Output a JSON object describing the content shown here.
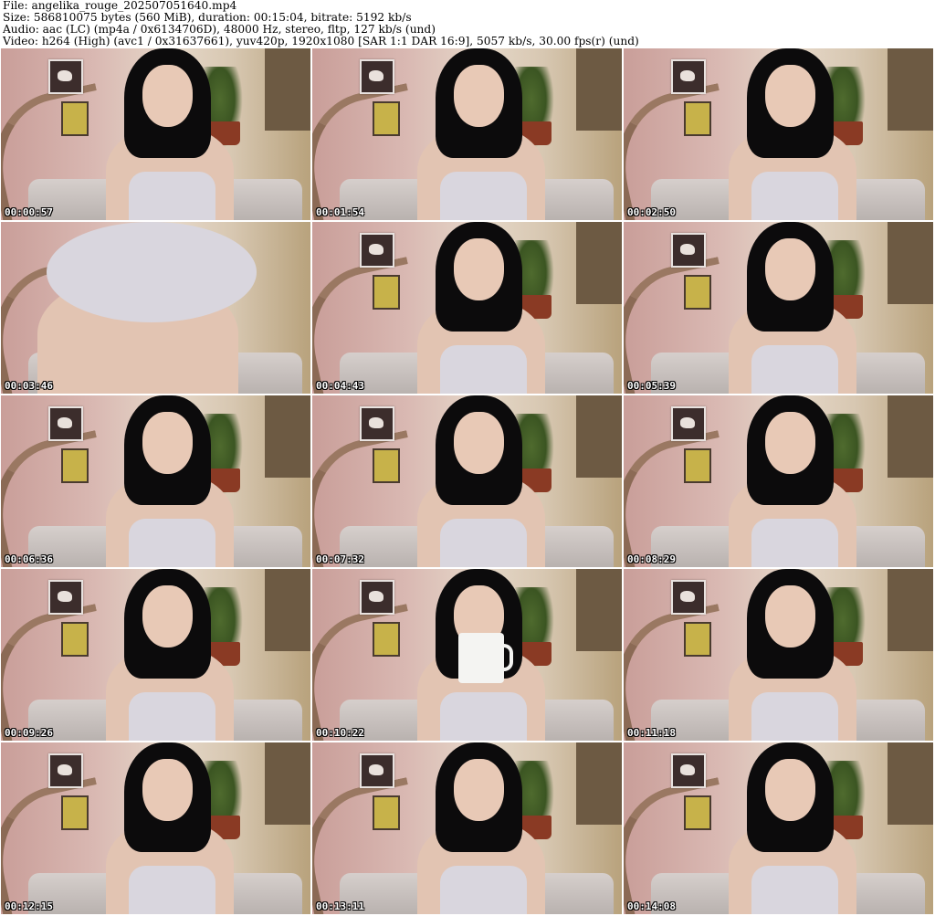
{
  "header": {
    "line1": "File: angelika_rouge_202507051640.mp4",
    "line2": "Size: 586810075 bytes (560 MiB), duration: 00:15:04, bitrate: 5192 kb/s",
    "line3": "Audio: aac (LC) (mp4a / 0x6134706D), 48000 Hz, stereo, fltp, 127 kb/s (und)",
    "line4": "Video: h264 (High) (avc1 / 0x31637661), yuv420p, 1920x1080 [SAR 1:1 DAR 16:9], 5057 kb/s, 30.00 fps(r) (und)"
  },
  "thumbnails": [
    {
      "timestamp": "00:00:57"
    },
    {
      "timestamp": "00:01:54"
    },
    {
      "timestamp": "00:02:50"
    },
    {
      "timestamp": "00:03:46"
    },
    {
      "timestamp": "00:04:43"
    },
    {
      "timestamp": "00:05:39"
    },
    {
      "timestamp": "00:06:36"
    },
    {
      "timestamp": "00:07:32"
    },
    {
      "timestamp": "00:08:29"
    },
    {
      "timestamp": "00:09:26"
    },
    {
      "timestamp": "00:10:22"
    },
    {
      "timestamp": "00:11:18"
    },
    {
      "timestamp": "00:12:15"
    },
    {
      "timestamp": "00:13:11"
    },
    {
      "timestamp": "00:14:08"
    }
  ]
}
